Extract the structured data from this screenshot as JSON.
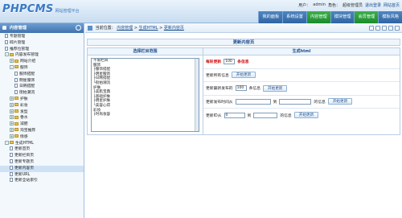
{
  "header": {
    "logo": "PHPCMS",
    "logo_sub": "网站管理平台",
    "user_label": "用户：",
    "user_name": "admin",
    "role_label": "角色：",
    "role": "超级管理员",
    "logout": "退出登录",
    "site_home": "网站首页"
  },
  "nav_tabs": [
    {
      "label": "我的面板",
      "active": false
    },
    {
      "label": "系统设置",
      "active": false
    },
    {
      "label": "内容管理",
      "active": true
    },
    {
      "label": "模块管理",
      "active": false
    },
    {
      "label": "会员管理",
      "active": true
    },
    {
      "label": "模板风格",
      "active": false
    }
  ],
  "sidebar": {
    "title": "内容管理",
    "items": [
      {
        "label": "专题管理"
      },
      {
        "label": "碎片管理"
      },
      {
        "label": "推荐位管理"
      },
      {
        "label": "内容发布管理"
      },
      {
        "label": "网站介绍"
      },
      {
        "label": "服饰"
      },
      {
        "label": "服饰搭配"
      },
      {
        "label": "明星服饰"
      },
      {
        "label": "日韩搭配"
      },
      {
        "label": "街拍潮流"
      },
      {
        "label": "护肤"
      },
      {
        "label": "彩妆"
      },
      {
        "label": "发型"
      },
      {
        "label": "香水"
      },
      {
        "label": "减肥"
      },
      {
        "label": "淘宝推荐"
      },
      {
        "label": "情感"
      },
      {
        "label": "生成HTML"
      },
      {
        "label": "更新首页"
      },
      {
        "label": "更新栏目页"
      },
      {
        "label": "更新专题页"
      },
      {
        "label": "更新内容页"
      },
      {
        "label": "更新URL"
      },
      {
        "label": "更新全站索引"
      }
    ]
  },
  "breadcrumb": {
    "prefix": "当前位置：",
    "p1": "内容管理",
    "p2": "生成HTML",
    "p3": "更新内容页",
    "sep": " > "
  },
  "main": {
    "title": "更新内容页",
    "left_header": "选择栏目范围",
    "right_header": "生成html",
    "category_options": [
      "不限栏目",
      "服饰",
      "├服饰搭配",
      "├明星服饰",
      "├日韩搭配",
      "└街拍潮流",
      "护肤",
      "├美肌宝典",
      "├基础护肤",
      "├明星护肤",
      "└美容心得",
      "彩妆",
      "├时尚妆容"
    ],
    "row1": {
      "label": "每轮更新",
      "value": "100",
      "unit": "条信息"
    },
    "row2": {
      "label": "更新所有信息",
      "button": "开始更新"
    },
    "row3": {
      "label": "更新最新发布的",
      "value": "100",
      "unit": "条信息",
      "button": "开始更新"
    },
    "row4": {
      "label": "更新发布时间从",
      "to": "到",
      "unit": "的信息",
      "button": "开始更新"
    },
    "row5": {
      "label": "更新ID从",
      "from_value": "0",
      "to": "到",
      "unit": "的信息",
      "button": "开始更新"
    }
  }
}
